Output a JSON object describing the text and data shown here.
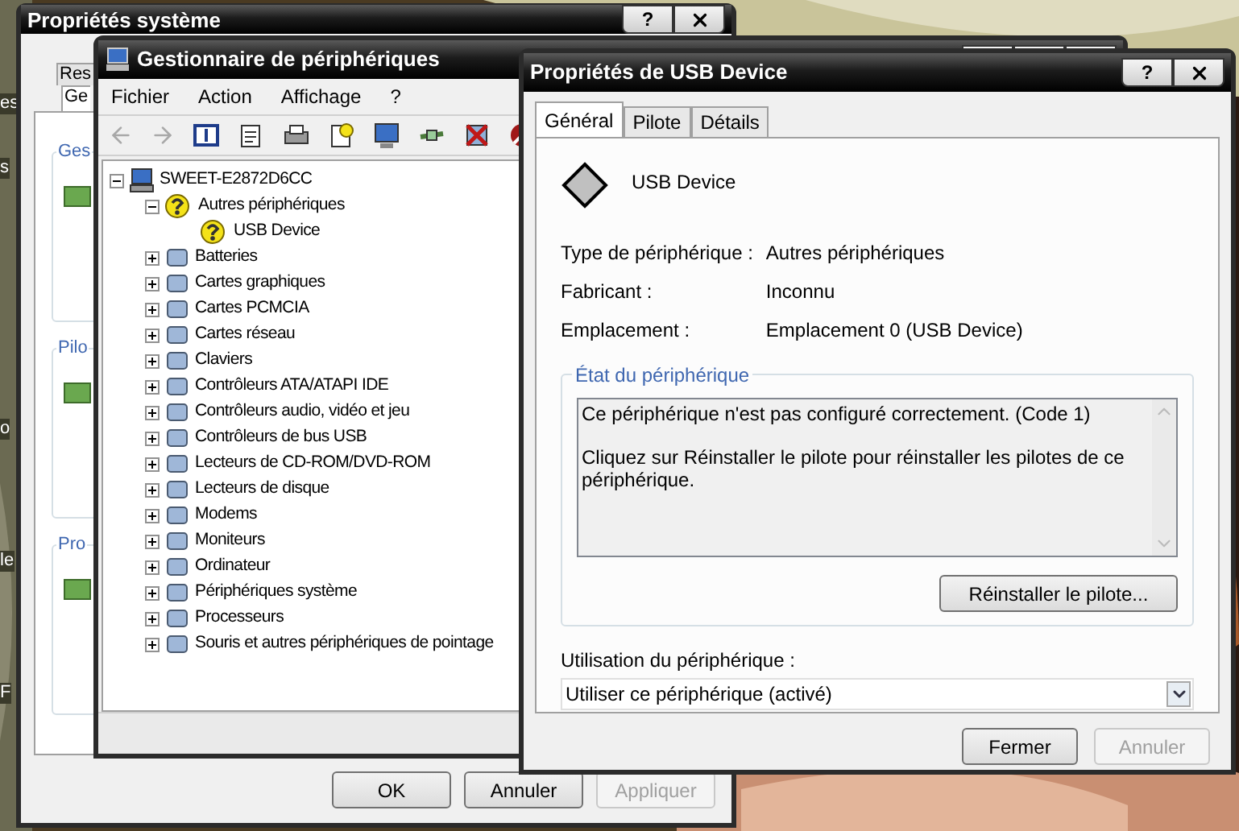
{
  "desktop": {
    "icon_labels": [
      "es",
      "s",
      "o",
      "le",
      "F"
    ]
  },
  "system_window": {
    "title": "Propriétés système",
    "help_button": "?",
    "tabs": [
      {
        "label": "Res",
        "selected": false
      },
      {
        "label": "Ge",
        "selected": true
      }
    ],
    "groups": [
      "Ges",
      "Pilo",
      "Pro"
    ],
    "buttons": [
      {
        "label": "OK",
        "disabled": false
      },
      {
        "label": "Annuler",
        "disabled": false
      },
      {
        "label": "Appliquer",
        "disabled": true
      }
    ]
  },
  "device_manager": {
    "title": "Gestionnaire de périphériques",
    "menu": [
      "Fichier",
      "Action",
      "Affichage",
      "?"
    ],
    "tree": {
      "label": "SWEET-E2872D6CC",
      "kind": "computer",
      "expanded": true,
      "children": [
        {
          "label": "Autres périphériques",
          "kind": "warning",
          "expanded": true,
          "children": [
            {
              "label": "USB Device",
              "kind": "warning"
            }
          ]
        },
        {
          "label": "Batteries",
          "kind": "device",
          "expanded": false
        },
        {
          "label": "Cartes graphiques",
          "kind": "device",
          "expanded": false
        },
        {
          "label": "Cartes PCMCIA",
          "kind": "device",
          "expanded": false
        },
        {
          "label": "Cartes réseau",
          "kind": "device",
          "expanded": false
        },
        {
          "label": "Claviers",
          "kind": "device",
          "expanded": false
        },
        {
          "label": "Contrôleurs ATA/ATAPI IDE",
          "kind": "device",
          "expanded": false
        },
        {
          "label": "Contrôleurs audio, vidéo et jeu",
          "kind": "device",
          "expanded": false
        },
        {
          "label": "Contrôleurs de bus USB",
          "kind": "device",
          "expanded": false
        },
        {
          "label": "Lecteurs de CD-ROM/DVD-ROM",
          "kind": "device",
          "expanded": false
        },
        {
          "label": "Lecteurs de disque",
          "kind": "device",
          "expanded": false
        },
        {
          "label": "Modems",
          "kind": "device",
          "expanded": false
        },
        {
          "label": "Moniteurs",
          "kind": "device",
          "expanded": false
        },
        {
          "label": "Ordinateur",
          "kind": "device",
          "expanded": false
        },
        {
          "label": "Périphériques système",
          "kind": "device",
          "expanded": false
        },
        {
          "label": "Processeurs",
          "kind": "device",
          "expanded": false
        },
        {
          "label": "Souris et autres périphériques de pointage",
          "kind": "device",
          "expanded": false
        }
      ]
    }
  },
  "usb_properties": {
    "title": "Propriétés de USB Device",
    "help_button": "?",
    "tabs": [
      {
        "label": "Général",
        "selected": true
      },
      {
        "label": "Pilote",
        "selected": false
      },
      {
        "label": "Détails",
        "selected": false
      }
    ],
    "device_name": "USB Device",
    "fields": [
      {
        "label": "Type de périphérique :",
        "value": "Autres périphériques"
      },
      {
        "label": "Fabricant :",
        "value": "Inconnu"
      },
      {
        "label": "Emplacement :",
        "value": "Emplacement 0 (USB Device)"
      }
    ],
    "status_group": {
      "title": "État du périphérique",
      "lines": [
        "Ce périphérique n'est pas configuré correctement. (Code 1)",
        "Cliquez sur Réinstaller le pilote pour réinstaller les pilotes de ce périphérique."
      ],
      "button": "Réinstaller le pilote..."
    },
    "usage": {
      "label": "Utilisation du périphérique :",
      "value": "Utiliser ce périphérique (activé)"
    },
    "buttons": [
      {
        "label": "Fermer",
        "disabled": false
      },
      {
        "label": "Annuler",
        "disabled": true
      }
    ]
  }
}
